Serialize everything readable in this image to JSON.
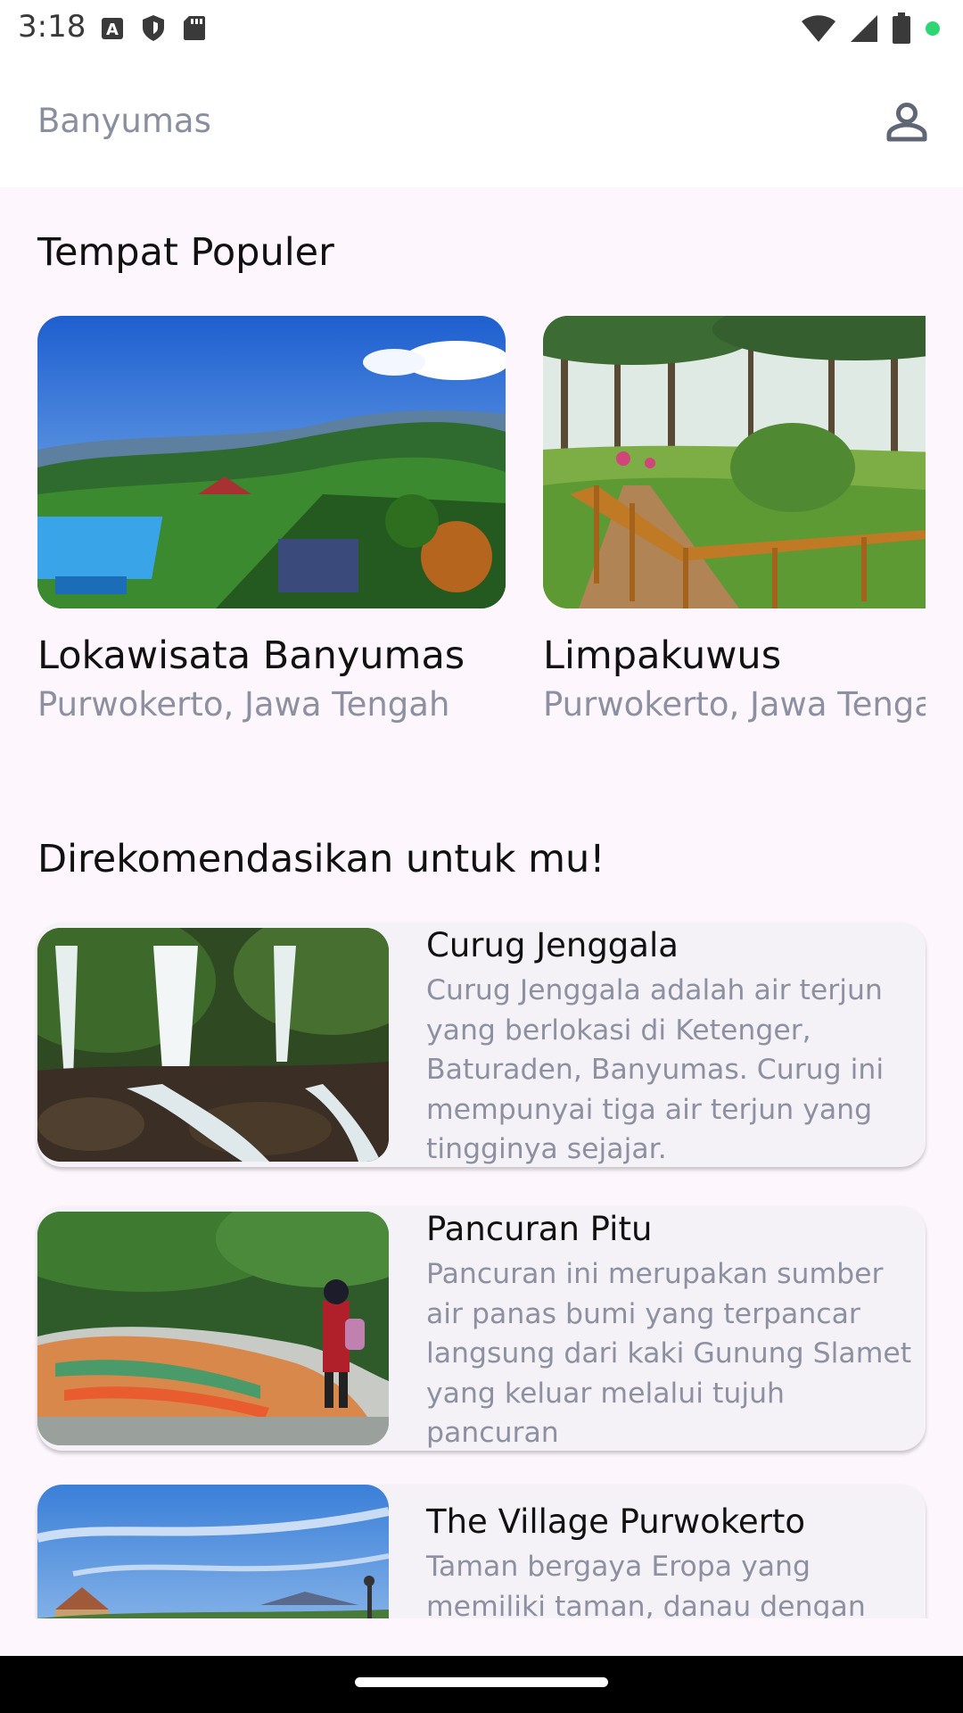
{
  "status_bar": {
    "time": "3:18",
    "left_icons": [
      "a-notification-icon",
      "shield-icon",
      "sd-card-icon"
    ],
    "right_icons": [
      "wifi-icon",
      "cell-signal-icon",
      "battery-icon",
      "camera-active-dot-icon"
    ]
  },
  "app_bar": {
    "title": "Banyumas",
    "profile_icon": "person-icon"
  },
  "popular": {
    "title": "Tempat Populer",
    "items": [
      {
        "name": "Lokawisata Banyumas",
        "location": "Purwokerto, Jawa Tengah",
        "image": "mountain-resort-pool-photo"
      },
      {
        "name": "Limpakuwus",
        "location": "Purwokerto, Jawa Tengah",
        "image": "pine-forest-bridge-photo"
      }
    ]
  },
  "recommended": {
    "title": "Direkomendasikan untuk mu!",
    "items": [
      {
        "name": "Curug Jenggala",
        "description": "Curug Jenggala adalah air terjun yang berlokasi di Ketenger, Baturaden, Banyumas. Curug ini mempunyai tiga air terjun yang tingginya sejajar.",
        "image": "waterfall-photo"
      },
      {
        "name": "Pancuran Pitu",
        "description": "Pancuran ini merupakan sumber air panas bumi yang terpancar langsung dari kaki Gunung Slamet yang keluar melalui tujuh pancuran",
        "image": "hot-spring-photo"
      },
      {
        "name": "The Village Purwokerto",
        "description": "Taman bergaya Eropa yang memiliki taman, danau dengan",
        "image": "village-sky-photo"
      }
    ]
  },
  "colors": {
    "background": "#fdf7fd",
    "card": "#f4f1f7",
    "muted_text": "#8c90a0"
  }
}
